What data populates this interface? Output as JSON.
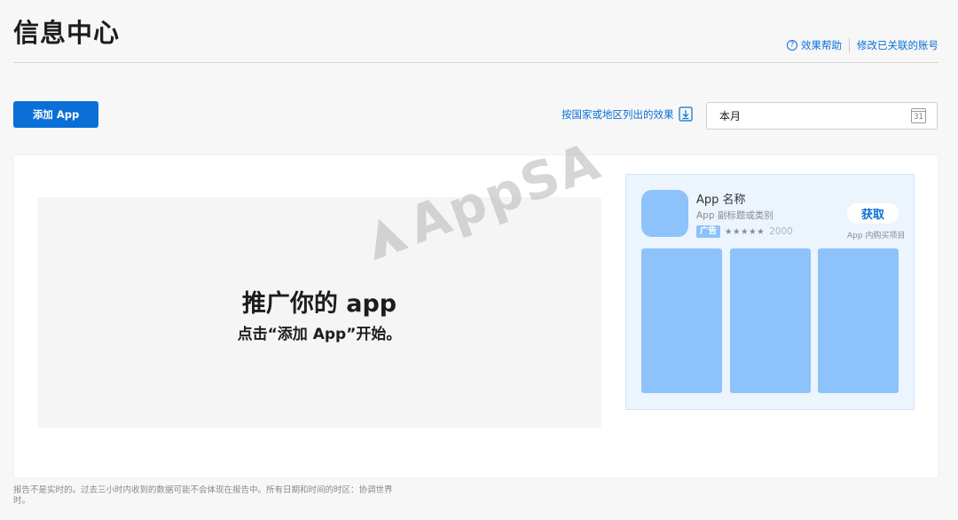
{
  "header": {
    "title": "信息中心",
    "help_label": "效果帮助",
    "help_icon": "question-circle-icon",
    "account_label": "修改已关联的账号"
  },
  "toolbar": {
    "add_app_label": "添加 App",
    "export_label": "按国家或地区列出的效果",
    "export_icon": "download-icon",
    "date_value": "本月",
    "calendar_icon_text": "31"
  },
  "promo": {
    "title": "推广你的 app",
    "subtitle": "点击“添加 App”开始。"
  },
  "ad_preview": {
    "app_name": "App 名称",
    "app_subtitle": "App 副标题或类别",
    "ad_badge": "广告",
    "stars": "★★★★★",
    "rating_count": "2000",
    "get_label": "获取",
    "iap_note": "App 内购买项目"
  },
  "watermark": {
    "text": "AppSA"
  },
  "footer": {
    "note": "报告不是实时的。过去三小时内收到的数据可能不会体现在报告中。所有日期和时间的时区：协调世界时。"
  },
  "colors": {
    "accent": "#0a6fd6",
    "placeholder_blue": "#8ec2fb",
    "preview_bg": "#ecf4fd",
    "page_bg": "#f7f7f7"
  }
}
